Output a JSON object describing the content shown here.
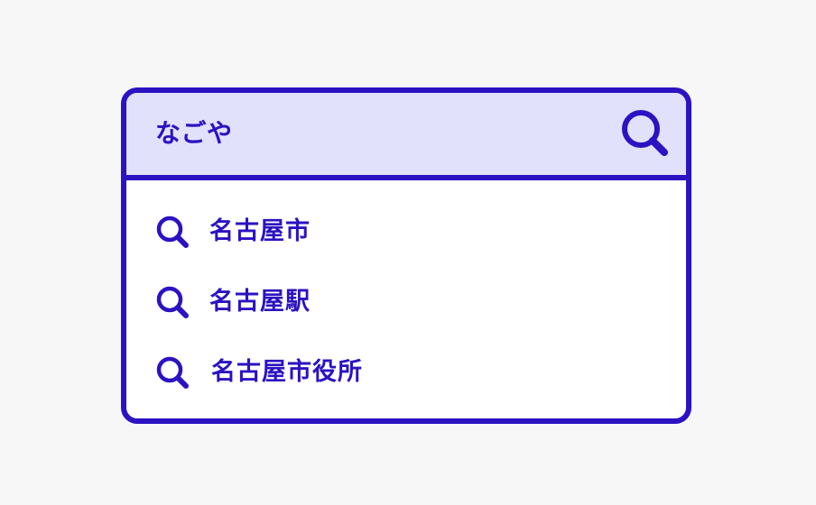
{
  "search": {
    "query": "なごや",
    "icon": "search-icon"
  },
  "suggestions": [
    {
      "label": "名古屋市",
      "icon": "search-icon"
    },
    {
      "label": "名古屋駅",
      "icon": "search-icon"
    },
    {
      "label": "名古屋市役所",
      "icon": "search-icon"
    }
  ],
  "colors": {
    "accent": "#2b12c2",
    "search_bar_bg": "#e1e1fc",
    "page_bg": "#f7f7f7",
    "panel_bg": "#ffffff"
  }
}
